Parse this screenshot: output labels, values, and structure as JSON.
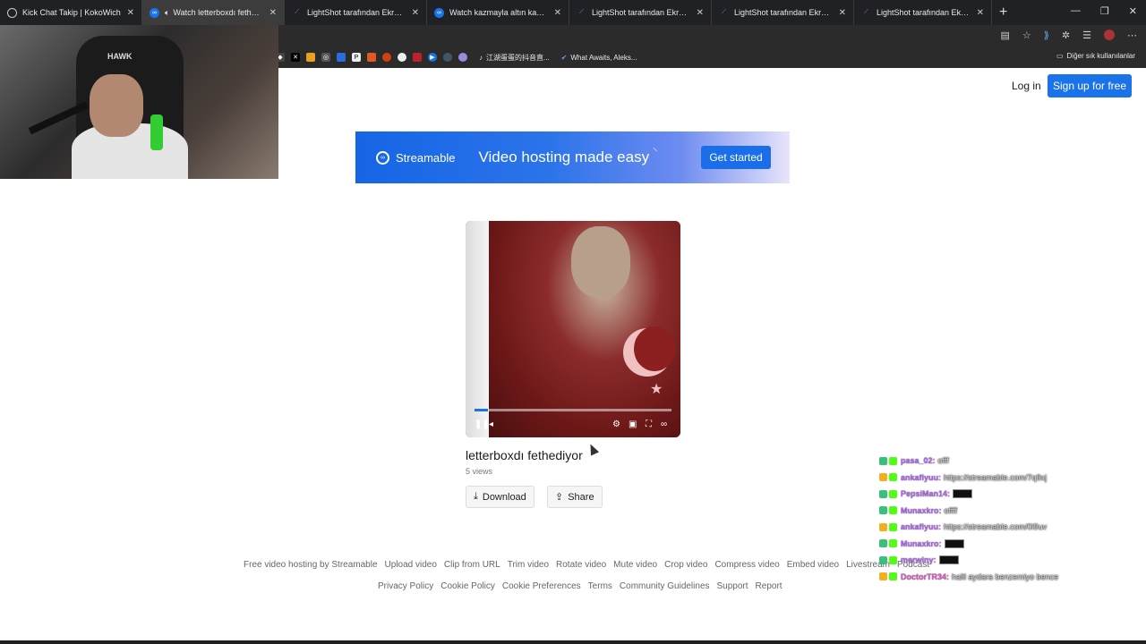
{
  "tabs": [
    {
      "title": "Kick Chat Takip | KokoWich",
      "icon": "globe-icon",
      "active": false
    },
    {
      "title": "Watch letterboxdı fethediyor",
      "icon": "streamable-icon",
      "active": true
    },
    {
      "title": "LightShot tarafından Ekran Görüntü",
      "icon": "feather-icon",
      "active": false
    },
    {
      "title": "Watch kazmayla altın kazıp eritip g",
      "icon": "streamable-icon",
      "active": false
    },
    {
      "title": "LightShot tarafından Ekran Görüntü",
      "icon": "feather-icon",
      "active": false
    },
    {
      "title": "LightShot tarafından Ekran Görüntü",
      "icon": "feather-icon",
      "active": false
    },
    {
      "title": "LightShot tarafından Ekran Görüntü",
      "icon": "feather-icon",
      "active": false
    }
  ],
  "bookmarks": {
    "item1": "江湖蛋蛋的抖音直...",
    "item2": "What Awaits, Aleks...",
    "other": "Diğer sık kullanılanlar"
  },
  "webcam": {
    "chair_logo": "HAWK"
  },
  "header": {
    "login": "Log in",
    "signup": "Sign up for free"
  },
  "banner": {
    "brand": "Streamable",
    "tagline": "Video hosting made easy",
    "cta": "Get started"
  },
  "video": {
    "title": "letterboxdı fethediyor",
    "views": "5 views",
    "progress": 0.07,
    "download": "Download",
    "share": "Share"
  },
  "footer": {
    "row1": [
      "Free video hosting by Streamable",
      "Upload video",
      "Clip from URL",
      "Trim video",
      "Rotate video",
      "Mute video",
      "Crop video",
      "Compress video",
      "Embed video",
      "Livestream",
      "Podcast"
    ],
    "row2": [
      "Privacy Policy",
      "Cookie Policy",
      "Cookie Preferences",
      "Terms",
      "Community Guidelines",
      "Support",
      "Report"
    ]
  },
  "chat": [
    {
      "user": "pasa_02:",
      "msg": "offf",
      "color": "#b36bf2",
      "emote": false
    },
    {
      "user": "ankafiyuu:",
      "msg": "https://streamable.com/7q9xj",
      "color": "#b36bf2",
      "emote": false
    },
    {
      "user": "PepsiMan14:",
      "msg": "",
      "color": "#b36bf2",
      "emote": true
    },
    {
      "user": "Munaxkro:",
      "msg": "offff",
      "color": "#b36bf2",
      "emote": false
    },
    {
      "user": "ankafiyuu:",
      "msg": "https://streamable.com/0i9uv",
      "color": "#b36bf2",
      "emote": false
    },
    {
      "user": "Munaxkro:",
      "msg": "",
      "color": "#b36bf2",
      "emote": true
    },
    {
      "user": "merwiny:",
      "msg": "",
      "color": "#b36bf2",
      "emote": true
    },
    {
      "user": "DoctorTR34:",
      "msg": "halil aydara benzemiyo bence",
      "color": "#e060c0",
      "emote": false
    }
  ]
}
